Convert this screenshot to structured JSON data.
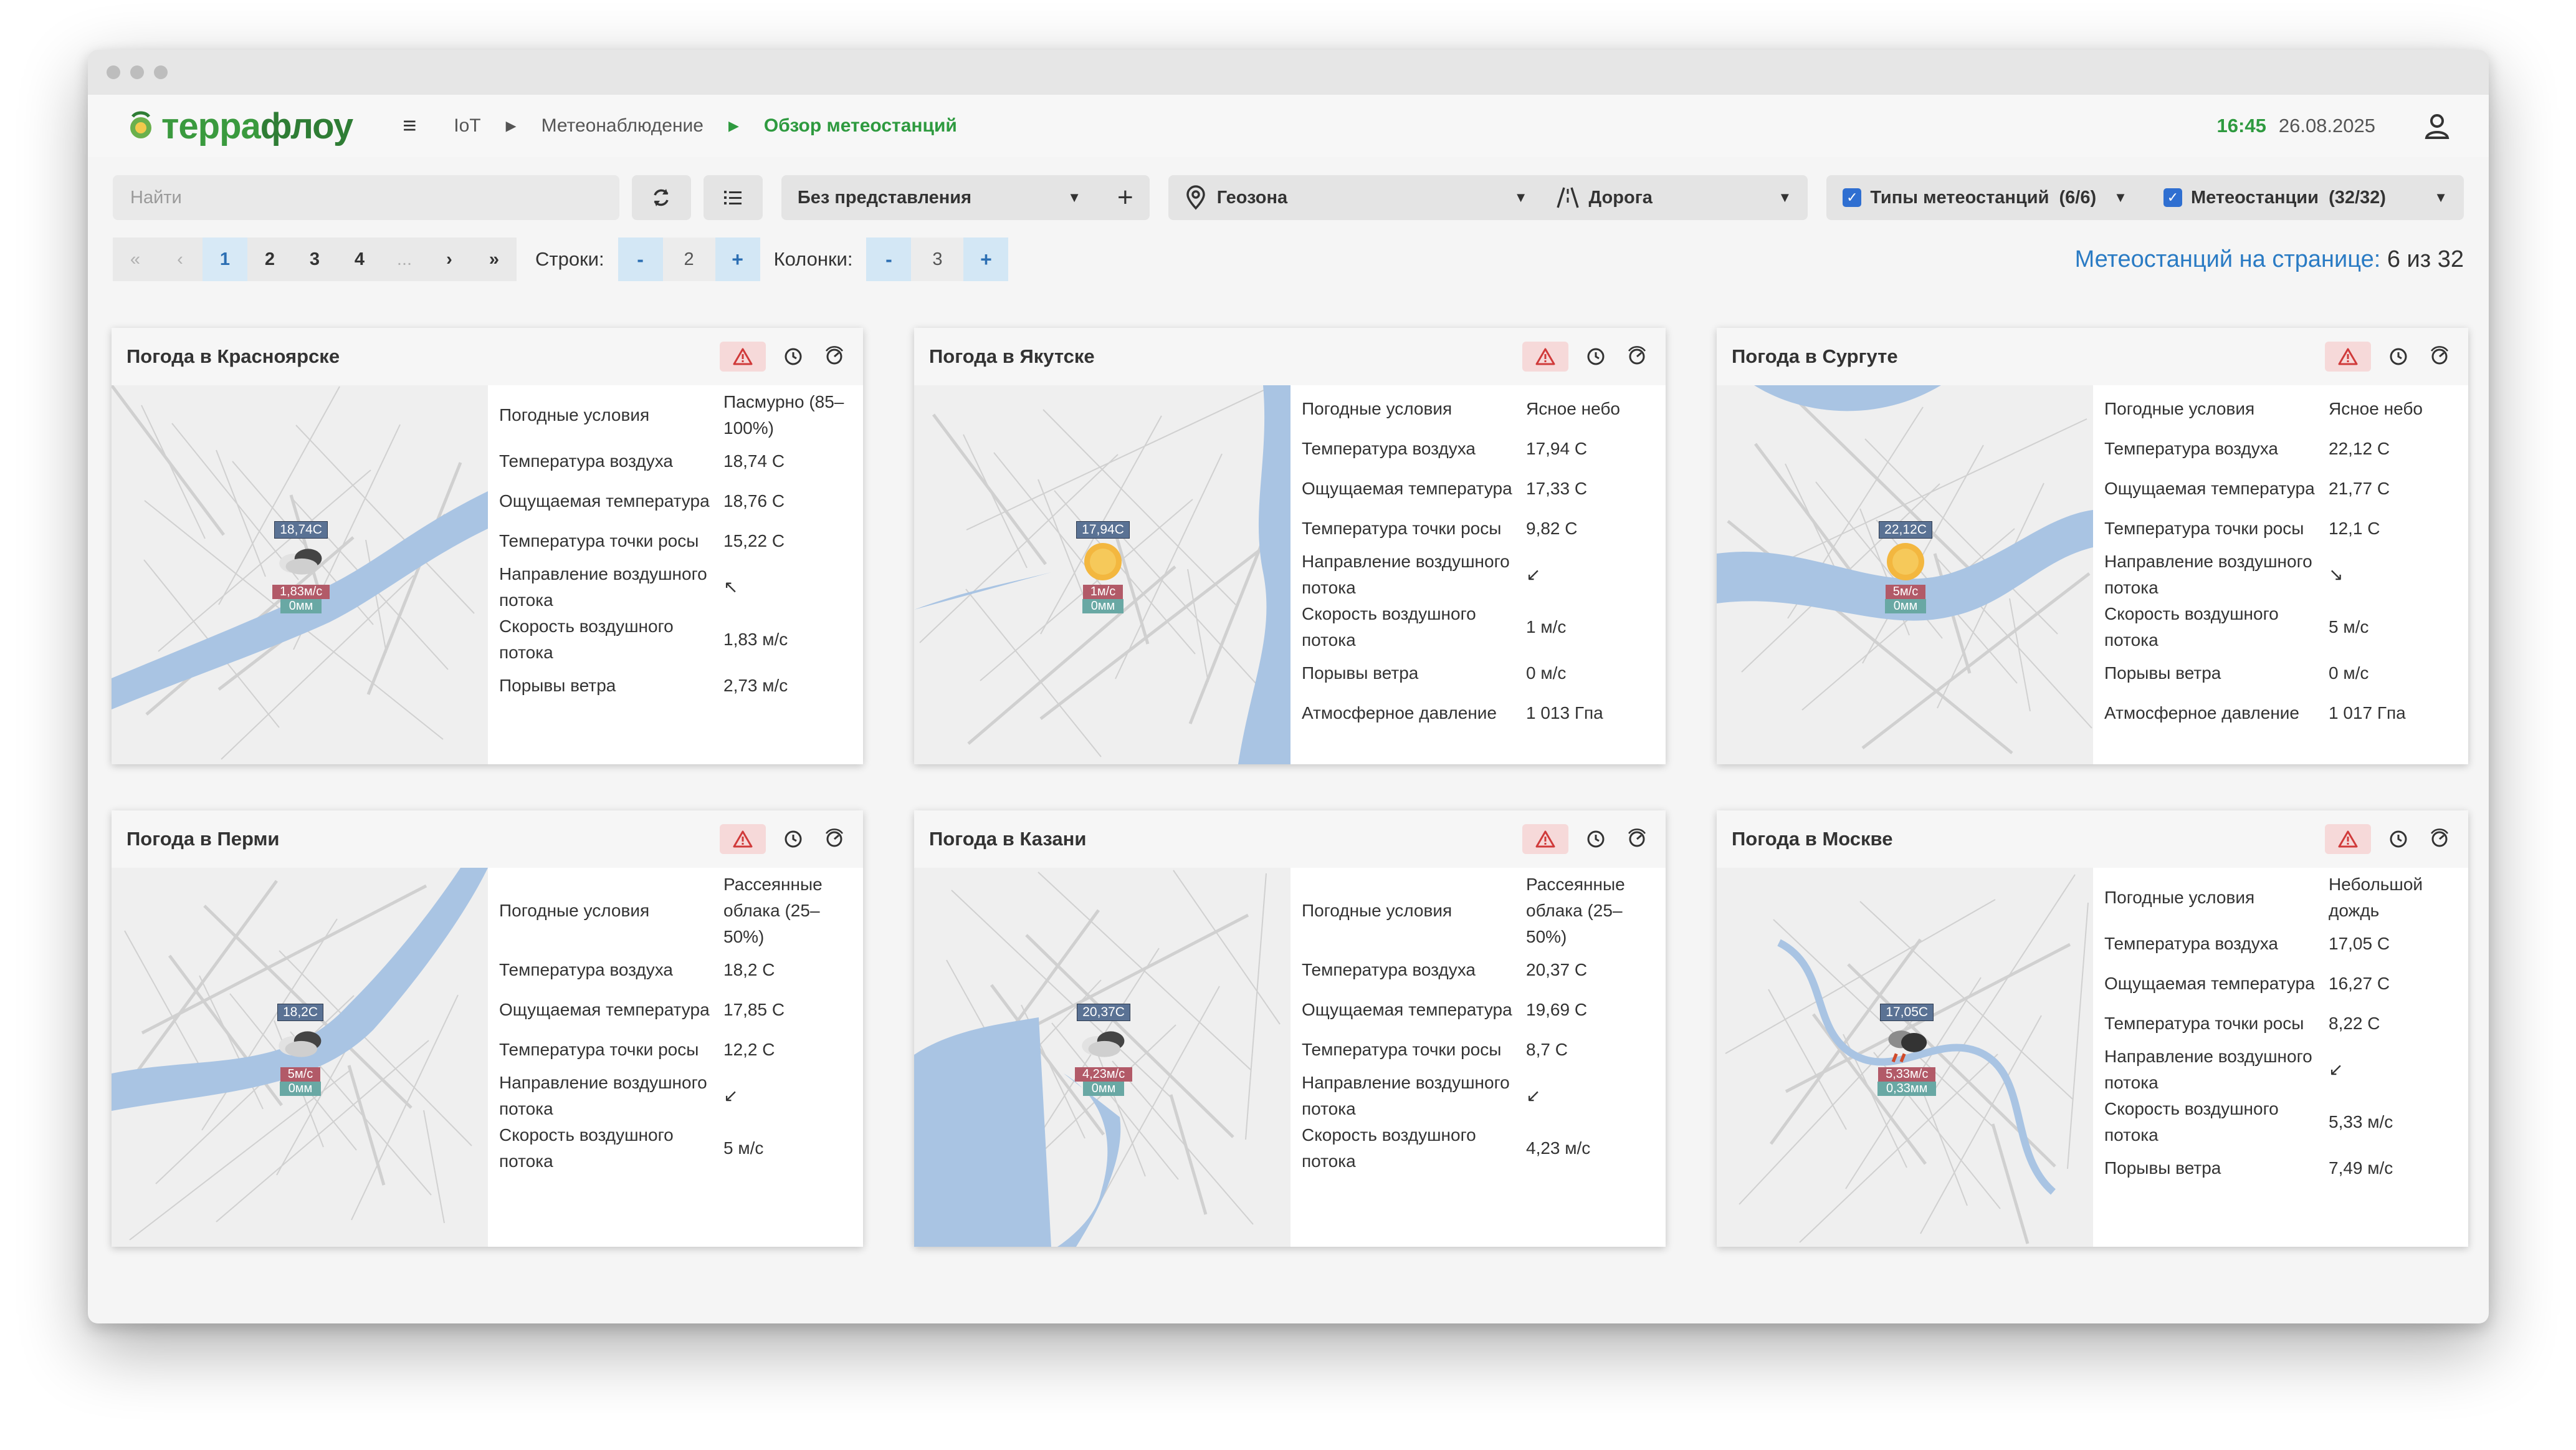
{
  "header": {
    "logo_part1": "терра",
    "logo_part2": "флоу",
    "breadcrumbs": [
      "IoT",
      "Метеонаблюдение",
      "Обзор метеостанций"
    ],
    "time": "16:45",
    "date": "26.08.2025"
  },
  "toolbar": {
    "search_placeholder": "Найти",
    "view_select": "Без представления",
    "geozone": "Геозона",
    "road": "Дорога",
    "station_types": "Типы метеостанций  (6/6)",
    "stations": "Метеостанции  (32/32)"
  },
  "pager": {
    "first": "«",
    "prev": "‹",
    "pages": [
      "1",
      "2",
      "3",
      "4"
    ],
    "ellipsis": "...",
    "next": "›",
    "last": "»",
    "rows_label": "Строки:",
    "rows_value": "2",
    "cols_label": "Колонки:",
    "cols_value": "3",
    "minus": "-",
    "plus": "+",
    "summary_label": "Метеостанций на странице:",
    "summary_value": "6 из 32"
  },
  "cards": [
    {
      "title": "Погода в Красноярске",
      "marker": {
        "temp": "18,74C",
        "wind": "1,83м/с",
        "precip": "0мм",
        "icon": "cloud-icon"
      },
      "rows": [
        {
          "label": "Погодные условия",
          "value": "Пасмурно (85–100%)"
        },
        {
          "label": "Температура воздуха",
          "value": "18,74 С"
        },
        {
          "label": "Ощущаемая температура",
          "value": "18,76 С"
        },
        {
          "label": "Температура точки росы",
          "value": "15,22 С"
        },
        {
          "label": "Направление воздушного потока",
          "value": "↖"
        },
        {
          "label": "Скорость воздушного потока",
          "value": "1,83 м/с"
        },
        {
          "label": "Порывы ветра",
          "value": "2,73 м/с"
        }
      ]
    },
    {
      "title": "Погода в Якутске",
      "marker": {
        "temp": "17,94C",
        "wind": "1м/с",
        "precip": "0мм",
        "icon": "sun-icon"
      },
      "rows": [
        {
          "label": "Погодные условия",
          "value": "Ясное небо"
        },
        {
          "label": "Температура воздуха",
          "value": "17,94 С"
        },
        {
          "label": "Ощущаемая температура",
          "value": "17,33 С"
        },
        {
          "label": "Температура точки росы",
          "value": "9,82 С"
        },
        {
          "label": "Направление воздушного потока",
          "value": "↙"
        },
        {
          "label": "Скорость воздушного потока",
          "value": "1 м/с"
        },
        {
          "label": "Порывы ветра",
          "value": "0 м/с"
        },
        {
          "label": "Атмосферное давление",
          "value": "1 013 Гпа"
        }
      ]
    },
    {
      "title": "Погода в Сургуте",
      "marker": {
        "temp": "22,12C",
        "wind": "5м/с",
        "precip": "0мм",
        "icon": "sun-icon"
      },
      "rows": [
        {
          "label": "Погодные условия",
          "value": "Ясное небо"
        },
        {
          "label": "Температура воздуха",
          "value": "22,12 С"
        },
        {
          "label": "Ощущаемая температура",
          "value": "21,77 С"
        },
        {
          "label": "Температура точки росы",
          "value": "12,1 С"
        },
        {
          "label": "Направление воздушного потока",
          "value": "↘"
        },
        {
          "label": "Скорость воздушного потока",
          "value": "5 м/с"
        },
        {
          "label": "Порывы ветра",
          "value": "0 м/с"
        },
        {
          "label": "Атмосферное давление",
          "value": "1 017 Гпа"
        }
      ]
    },
    {
      "title": "Погода в Перми",
      "marker": {
        "temp": "18,2C",
        "wind": "5м/с",
        "precip": "0мм",
        "icon": "cloud-icon"
      },
      "rows": [
        {
          "label": "Погодные условия",
          "value": "Рассеянные облака (25–50%)"
        },
        {
          "label": "Температура воздуха",
          "value": "18,2 С"
        },
        {
          "label": "Ощущаемая температура",
          "value": "17,85 С"
        },
        {
          "label": "Температура точки росы",
          "value": "12,2 С"
        },
        {
          "label": "Направление воздушного потока",
          "value": "↙"
        },
        {
          "label": "Скорость воздушного потока",
          "value": "5 м/с"
        }
      ]
    },
    {
      "title": "Погода в Казани",
      "marker": {
        "temp": "20,37C",
        "wind": "4,23м/с",
        "precip": "0мм",
        "icon": "cloud-icon"
      },
      "rows": [
        {
          "label": "Погодные условия",
          "value": "Рассеянные облака (25–50%)"
        },
        {
          "label": "Температура воздуха",
          "value": "20,37 С"
        },
        {
          "label": "Ощущаемая температура",
          "value": "19,69 С"
        },
        {
          "label": "Температура точки росы",
          "value": "8,7 С"
        },
        {
          "label": "Направление воздушного потока",
          "value": "↙"
        },
        {
          "label": "Скорость воздушного потока",
          "value": "4,23 м/с"
        }
      ]
    },
    {
      "title": "Погода в Москве",
      "marker": {
        "temp": "17,05C",
        "wind": "5,33м/с",
        "precip": "0,33мм",
        "icon": "rain-cloud-icon"
      },
      "rows": [
        {
          "label": "Погодные условия",
          "value": "Небольшой дождь"
        },
        {
          "label": "Температура воздуха",
          "value": "17,05 С"
        },
        {
          "label": "Ощущаемая температура",
          "value": "16,27 С"
        },
        {
          "label": "Температура точки росы",
          "value": "8,22 С"
        },
        {
          "label": "Направление воздушного потока",
          "value": "↙"
        },
        {
          "label": "Скорость воздушного потока",
          "value": "5,33 м/с"
        },
        {
          "label": "Порывы ветра",
          "value": "7,49 м/с"
        }
      ]
    }
  ]
}
